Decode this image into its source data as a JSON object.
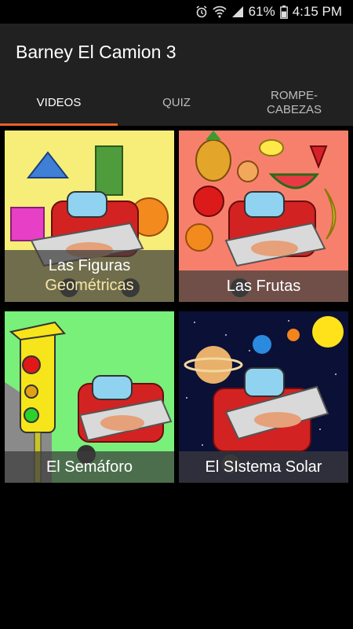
{
  "status": {
    "battery": "61%",
    "time": "4:15 PM"
  },
  "app": {
    "title": "Barney El Camion 3"
  },
  "tabs": [
    {
      "label": "VIDEOS",
      "active": true
    },
    {
      "label": "QUIZ",
      "active": false
    },
    {
      "label": "ROMPE-\nCABEZAS",
      "active": false
    }
  ],
  "cards": [
    {
      "line1": "Las Figuras",
      "line2": "Geométricas",
      "bg": "#f6ee78"
    },
    {
      "line1": "Las Frutas",
      "bg": "#f7806c"
    },
    {
      "line1": "El Semáforo",
      "bg": "#78f07a"
    },
    {
      "line1": "El SIstema Solar",
      "bg": "#0b1036"
    }
  ],
  "colors": {
    "accent": "#e8622a",
    "bar": "#212121"
  }
}
